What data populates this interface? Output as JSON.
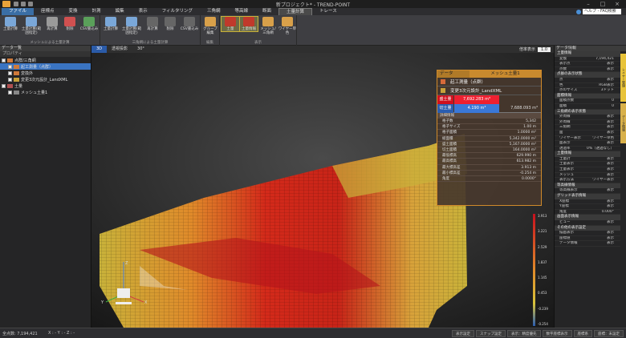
{
  "window": {
    "title": "新プロジェクト* - TREND-POINT",
    "help_search": "ヘルプ - FAQ検索"
  },
  "menu": [
    "ファイル",
    "座標点",
    "変換",
    "計測",
    "編集",
    "表示",
    "フィルタリング",
    "三角網",
    "等高線",
    "断面",
    "土量計算",
    "トレース"
  ],
  "ribbon": {
    "buttons": [
      "土量計算",
      "土量計算(範囲指定)",
      "再計算",
      "削除",
      "CSV書込み",
      "土量計算",
      "土量計算(範囲指定)",
      "再計算",
      "削除",
      "CSV書込み",
      "グループ編集",
      "土量",
      "土量情報",
      "メッシュ/三角網",
      "ワイヤー単色"
    ],
    "groups": [
      "メッシュによる土量計算",
      "三角網による土量計算",
      "編集",
      "表示"
    ]
  },
  "left_panel": {
    "title": "データ一覧",
    "toolbar": "プロパティ",
    "tree": [
      {
        "label": "点群/三角網",
        "level": 0
      },
      {
        "label": "起工測量（点群）",
        "level": 1
      },
      {
        "label": "変換外",
        "level": 1
      },
      {
        "label": "変更3次元設計_LandXML",
        "level": 1
      },
      {
        "label": "土量",
        "level": 0
      },
      {
        "label": "メッシュ土量1",
        "level": 1
      }
    ]
  },
  "viewport": {
    "tabs": [
      "3D",
      "透視投影",
      "30°"
    ],
    "zoom_label": "倍率表示",
    "zoom_value": "1.0"
  },
  "data_panel": {
    "header_left": "データ",
    "header_right": "メッシュ土量1",
    "source": "起工測量（点群）",
    "design": "変更3次元設計_LandXML",
    "fill_label": "盛土量",
    "fill_value": "7,692.283 m³",
    "cut_label": "切土量",
    "cut_value": "4.190 m³",
    "net_value": "7,688.093 m³",
    "details_title": "詳細情報",
    "details": [
      {
        "k": "格子数",
        "v": "5,342"
      },
      {
        "k": "格子サイズ",
        "v": "1.00 m"
      },
      {
        "k": "格子面積",
        "v": "1.0000 m²"
      },
      {
        "k": "総面積",
        "v": "5,342.0000 m²"
      },
      {
        "k": "盛土面積",
        "v": "5,167.0000 m²"
      },
      {
        "k": "切土面積",
        "v": "164.0000 m²"
      },
      {
        "k": "最低標高",
        "v": "629.990 m"
      },
      {
        "k": "最高標高",
        "v": "613.982 m"
      },
      {
        "k": "最大標高差",
        "v": "3.913 m"
      },
      {
        "k": "最小標高差",
        "v": "-0.254 m"
      },
      {
        "k": "角度",
        "v": "0.0000°"
      }
    ]
  },
  "legend": {
    "ticks": [
      "3.913",
      "3.221",
      "2.529",
      "1.837",
      "1.145",
      "0.453",
      "-0.239",
      "-0.254"
    ]
  },
  "right_panel": {
    "title": "データ情報",
    "rows": [
      {
        "type": "sec",
        "k": "土量情報"
      },
      {
        "k": "変換",
        "v": "7,194,421"
      },
      {
        "k": "表示点",
        "v": "表示"
      },
      {
        "k": "点数",
        "v": "表示"
      },
      {
        "type": "sec",
        "k": "点群の表示状態"
      },
      {
        "k": "点",
        "v": "表示"
      },
      {
        "k": "色",
        "v": "RGB表示"
      },
      {
        "k": "点のサイズ",
        "v": "3ドット"
      },
      {
        "type": "sec",
        "k": "面積情報"
      },
      {
        "k": "面積点数",
        "v": "0"
      },
      {
        "k": "面積",
        "v": "0"
      },
      {
        "type": "sec",
        "k": "三角網の表示状態"
      },
      {
        "k": "外周線",
        "v": "表示"
      },
      {
        "k": "外周線",
        "v": "表示"
      },
      {
        "k": "三角網",
        "v": "表示"
      },
      {
        "k": "面",
        "v": "表示"
      },
      {
        "k": "ワイヤー表示",
        "v": "ワイヤー単色"
      },
      {
        "k": "面表示",
        "v": "表示"
      },
      {
        "k": "透過率",
        "v": "0%（透過なし）"
      },
      {
        "type": "sec",
        "k": "土量情報"
      },
      {
        "k": "土量計",
        "v": "表示"
      },
      {
        "k": "土量表示",
        "v": "表示"
      },
      {
        "k": "土量表示",
        "v": "表示"
      },
      {
        "k": "メッシュ",
        "v": "表示"
      },
      {
        "k": "表示方法",
        "v": "ワイヤー表示"
      },
      {
        "type": "sec",
        "k": "等高線情報"
      },
      {
        "k": "等高線表示",
        "v": "表示"
      },
      {
        "type": "sec",
        "k": "グリッド表示情報"
      },
      {
        "k": "X座標",
        "v": "表示"
      },
      {
        "k": "Y座標",
        "v": "表示"
      },
      {
        "k": "角度",
        "v": "0.000°"
      },
      {
        "type": "sec",
        "k": "画面表示情報"
      },
      {
        "k": "ビュー",
        "v": "表示"
      },
      {
        "type": "sec",
        "k": "その他の表示設定"
      },
      {
        "k": "描画表示",
        "v": "表示"
      },
      {
        "k": "座標値",
        "v": "表示"
      },
      {
        "k": "データ情報",
        "v": "表示"
      }
    ],
    "side_tabs": [
      "レイヤー管理",
      "データ情報"
    ]
  },
  "statusbar": {
    "left": "全点数: 7,194,421",
    "coords": "X : - Y : - Z : -",
    "buttons": [
      "表示設定",
      "スナップ設定",
      "表示：精度優先",
      "数字座標表示",
      "座標系",
      "座標：未設定"
    ]
  },
  "colors": {
    "accent": "#c98a2e",
    "fill_red": "#d0101e",
    "cut_blue": "#2a5db0",
    "selection": "#3a74c2"
  }
}
